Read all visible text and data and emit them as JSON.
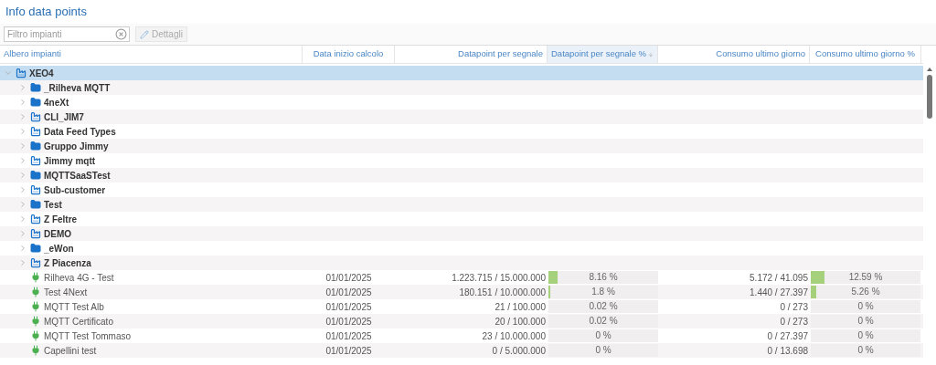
{
  "title": "Info data points",
  "toolbar": {
    "filter": {
      "placeholder": "Filtro impianti"
    },
    "details_button": {
      "label": "Dettagli",
      "disabled": true
    }
  },
  "table": {
    "columns": [
      {
        "label": "Albero impianti",
        "sorted": false
      },
      {
        "label": "Data inizio calcolo",
        "sorted": false
      },
      {
        "label": "Datapoint per segnale",
        "sorted": false
      },
      {
        "label": "Datapoint per segnale %",
        "sorted": true
      },
      {
        "label": "Consumo ultimo giorno",
        "sorted": false
      },
      {
        "label": "Consumo ultimo giorno %",
        "sorted": false
      }
    ],
    "tree": [
      {
        "kind": "plant",
        "name": "XEO4",
        "expanded": true,
        "selected": true,
        "children": [
          {
            "kind": "folder",
            "name": "_Rilheva MQTT",
            "expanded": false,
            "selected": false
          },
          {
            "kind": "folder",
            "name": "4neXt",
            "expanded": false,
            "selected": false
          },
          {
            "kind": "plant",
            "name": "CLI_JIM7",
            "expanded": false,
            "selected": false
          },
          {
            "kind": "plant",
            "name": "Data Feed Types",
            "expanded": false,
            "selected": false
          },
          {
            "kind": "folder",
            "name": "Gruppo Jimmy",
            "expanded": false,
            "selected": false
          },
          {
            "kind": "plant",
            "name": "Jimmy mqtt",
            "expanded": false,
            "selected": false
          },
          {
            "kind": "folder",
            "name": "MQTTSaaSTest",
            "expanded": false,
            "selected": false
          },
          {
            "kind": "plant",
            "name": "Sub-customer",
            "expanded": false,
            "selected": false
          },
          {
            "kind": "folder",
            "name": "Test",
            "expanded": false,
            "selected": false
          },
          {
            "kind": "plant",
            "name": "Z Feltre",
            "expanded": false,
            "selected": false
          },
          {
            "kind": "plant",
            "name": "DEMO",
            "expanded": false,
            "selected": false
          },
          {
            "kind": "folder",
            "name": "_eWon",
            "expanded": false,
            "selected": false
          },
          {
            "kind": "plant",
            "name": "Z Piacenza",
            "expanded": false,
            "selected": false
          },
          {
            "kind": "device",
            "name": "Rilheva 4G - Test",
            "selected": false,
            "start": "01/01/2025",
            "datapoints": "1.223.715 / 15.000.000",
            "dp_meter": {
              "level": 0.0816,
              "reading": "8.16 %"
            },
            "consumption": "5.172 / 41.095",
            "cons_meter": {
              "level": 0.1259,
              "reading": "12.59 %"
            }
          },
          {
            "kind": "device",
            "name": "Test 4Next",
            "selected": false,
            "start": "01/01/2025",
            "datapoints": "180.151 / 10.000.000",
            "dp_meter": {
              "level": 0.018,
              "reading": "1.8 %"
            },
            "consumption": "1.440 / 27.397",
            "cons_meter": {
              "level": 0.0526,
              "reading": "5.26 %"
            }
          },
          {
            "kind": "device",
            "name": "MQTT Test Alb",
            "selected": false,
            "start": "01/01/2025",
            "datapoints": "21 / 100.000",
            "dp_meter": {
              "level": 0.0002,
              "reading": "0.02 %"
            },
            "consumption": "0 / 273",
            "cons_meter": {
              "reading": "0 %"
            }
          },
          {
            "kind": "device",
            "name": "MQTT Certificato",
            "selected": false,
            "start": "01/01/2025",
            "datapoints": "20 / 100.000",
            "dp_meter": {
              "level": 0.0002,
              "reading": "0.02 %"
            },
            "consumption": "0 / 273",
            "cons_meter": {
              "reading": "0 %"
            }
          },
          {
            "kind": "device",
            "name": "MQTT Test Tommaso",
            "selected": false,
            "start": "01/01/2025",
            "datapoints": "23 / 10.000.000",
            "dp_meter": {
              "reading": "0 %"
            },
            "consumption": "0 / 27.397",
            "cons_meter": {
              "reading": "0 %"
            }
          },
          {
            "kind": "device",
            "name": "Capellini test",
            "selected": false,
            "start": "01/01/2025",
            "datapoints": "0 / 5.000.000",
            "dp_meter": {
              "reading": "0 %"
            },
            "consumption": "0 / 13.698",
            "cons_meter": {
              "reading": "0 %"
            }
          }
        ]
      }
    ]
  }
}
